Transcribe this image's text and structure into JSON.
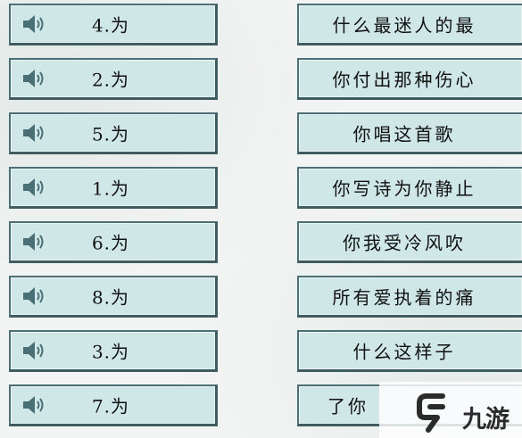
{
  "left_cards": [
    {
      "label": "4.为"
    },
    {
      "label": "2.为"
    },
    {
      "label": "5.为"
    },
    {
      "label": "1.为"
    },
    {
      "label": "6.为"
    },
    {
      "label": "8.为"
    },
    {
      "label": "3.为"
    },
    {
      "label": "7.为"
    }
  ],
  "right_cards": [
    {
      "text": "什么最迷人的最"
    },
    {
      "text": "你付出那种伤心"
    },
    {
      "text": "你唱这首歌"
    },
    {
      "text": "你写诗为你静止"
    },
    {
      "text": "你我受冷风吹"
    },
    {
      "text": "所有爱执着的痛"
    },
    {
      "text": "什么这样子"
    },
    {
      "text": "了你"
    }
  ],
  "watermark": {
    "brand_text": "九游"
  },
  "colors": {
    "card_fill": "#cfe7e6",
    "card_border": "#4c6f75",
    "speaker_icon": "#4a6f76"
  },
  "icons": {
    "play_audio": "speaker-icon",
    "brand_logo": "nine-game-logo-icon"
  }
}
